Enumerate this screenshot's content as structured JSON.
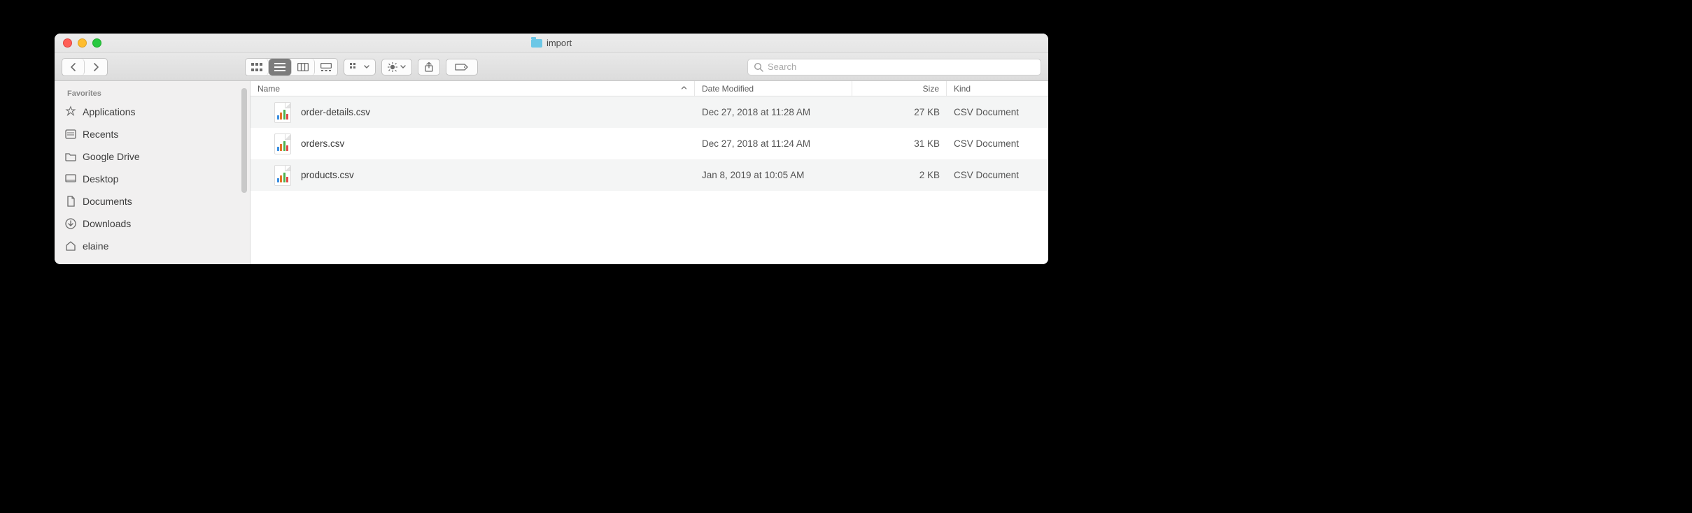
{
  "window": {
    "title": "import"
  },
  "search": {
    "placeholder": "Search"
  },
  "sidebar": {
    "heading": "Favorites",
    "items": [
      {
        "label": "Applications",
        "icon": "apps"
      },
      {
        "label": "Recents",
        "icon": "recents"
      },
      {
        "label": "Google Drive",
        "icon": "folder"
      },
      {
        "label": "Desktop",
        "icon": "desktop"
      },
      {
        "label": "Documents",
        "icon": "documents"
      },
      {
        "label": "Downloads",
        "icon": "downloads"
      },
      {
        "label": "elaine",
        "icon": "home"
      }
    ]
  },
  "columns": {
    "name": "Name",
    "date": "Date Modified",
    "size": "Size",
    "kind": "Kind"
  },
  "files": [
    {
      "name": "order-details.csv",
      "date": "Dec 27, 2018 at 11:28 AM",
      "size": "27 KB",
      "kind": "CSV Document"
    },
    {
      "name": "orders.csv",
      "date": "Dec 27, 2018 at 11:24 AM",
      "size": "31 KB",
      "kind": "CSV Document"
    },
    {
      "name": "products.csv",
      "date": "Jan 8, 2019 at 10:05 AM",
      "size": "2 KB",
      "kind": "CSV Document"
    }
  ]
}
